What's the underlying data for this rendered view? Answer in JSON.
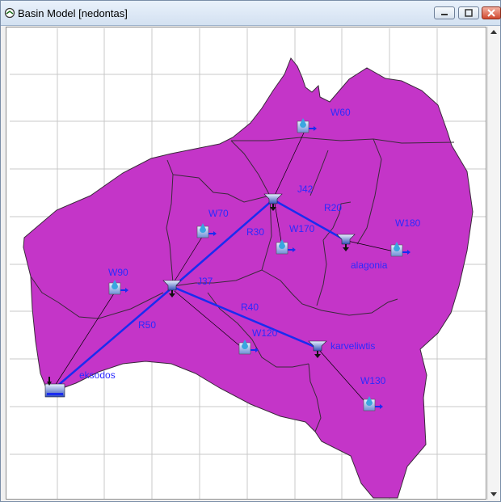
{
  "window": {
    "title": "Basin Model [nedontas]"
  },
  "elements": {
    "subbasins": {
      "w60": "W60",
      "w70": "W70",
      "w90": "W90",
      "w120": "W120",
      "w130": "W130",
      "w170": "W170",
      "w180": "W180"
    },
    "junctions": {
      "j42": "J42",
      "j37": "J37",
      "alagonia": "alagonia",
      "karveliwtis": "karveliwtis"
    },
    "reaches": {
      "r20": "R20",
      "r30": "R30",
      "r40": "R40",
      "r50": "R50"
    },
    "sink": {
      "eksodos": "eksodos"
    }
  },
  "colors": {
    "basin_fill": "#c435c8",
    "basin_border": "#3a2a3a",
    "reach_line": "#1a2cf0",
    "label_text": "#2a2aff",
    "grid_line": "#c8c8c8"
  },
  "icons": {
    "subbasin": "subbasin-icon",
    "junction": "junction-icon",
    "sink": "sink-icon"
  }
}
